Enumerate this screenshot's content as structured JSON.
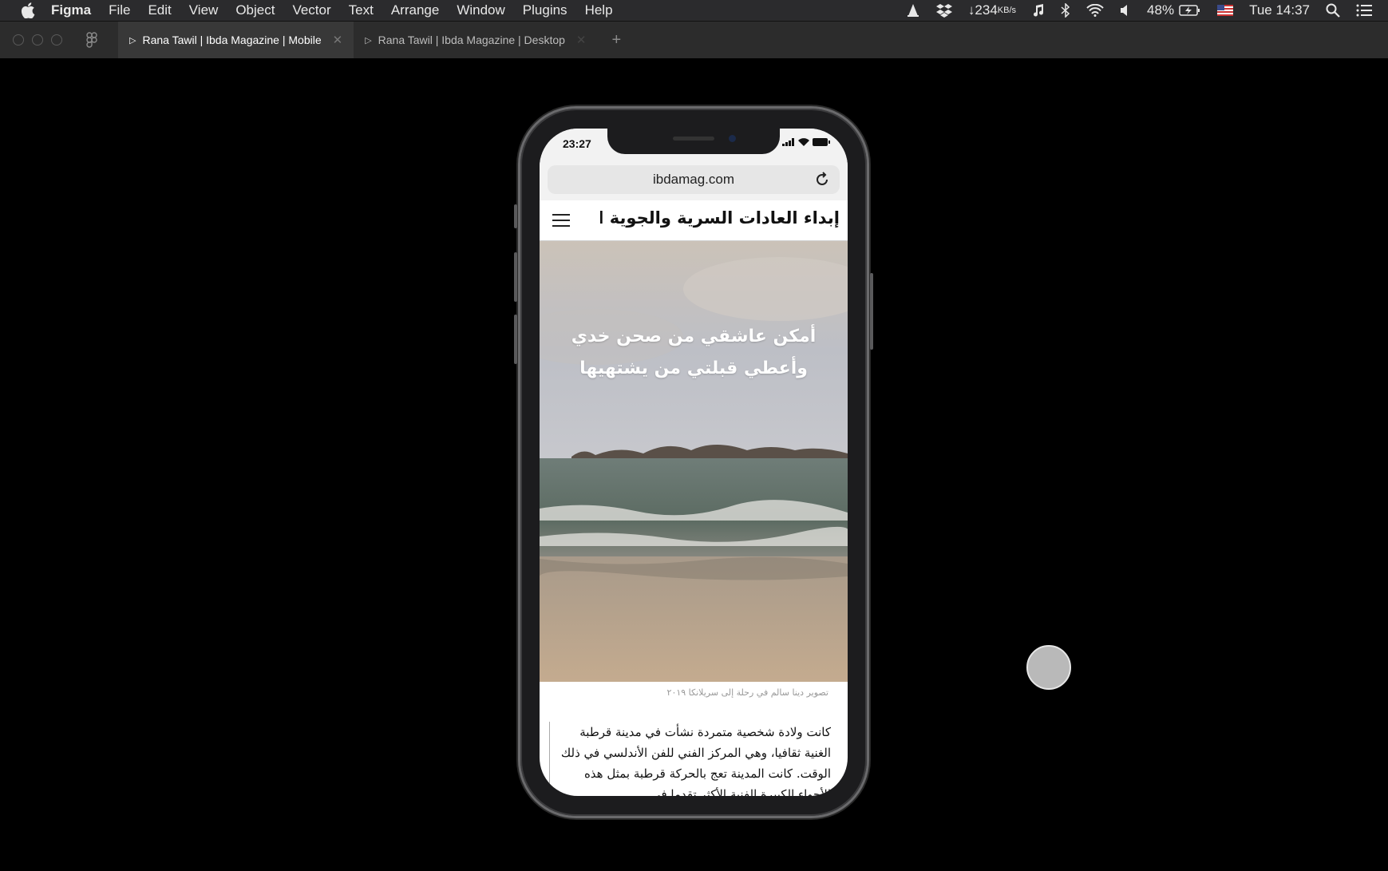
{
  "menubar": {
    "app": "Figma",
    "items": [
      "File",
      "Edit",
      "View",
      "Object",
      "Vector",
      "Text",
      "Arrange",
      "Window",
      "Plugins",
      "Help"
    ],
    "net_speed": "↓234",
    "net_unit": "KB/s",
    "battery": "48%",
    "clock": "Tue 14:37"
  },
  "tabs": [
    {
      "label": "Rana Tawil | Ibda Magazine | Mobile",
      "active": true
    },
    {
      "label": "Rana Tawil | Ibda Magazine | Desktop",
      "active": false
    }
  ],
  "phone": {
    "time": "23:27",
    "url": "ibdamag.com",
    "site_logo": "إبداء العادات السرية والجوية الخفية",
    "hero_line1": "أمكن عاشقي من صحن خدي",
    "hero_line2": "وأعطي قبلتي من يشتهيها",
    "caption": "تصوير دينا سالم في رحلة إلى سريلانكا ٢٠١٩",
    "article_text": "كانت ولادة شخصية متمردة نشأت في مدينة قرطبة الغنية ثقافيا، وهي المركز الفني للفن الأندلسي في ذلك الوقت. كانت المدينة تعج بالحركة قرطبة بمثل هذه الأجواء الكبيرة الفنية الأكثر تقدما في"
  },
  "icons": {
    "apple": "apple-logo-icon",
    "figma": "figma-logo-icon",
    "reload": "reload-icon",
    "menu": "hamburger-menu-icon"
  }
}
